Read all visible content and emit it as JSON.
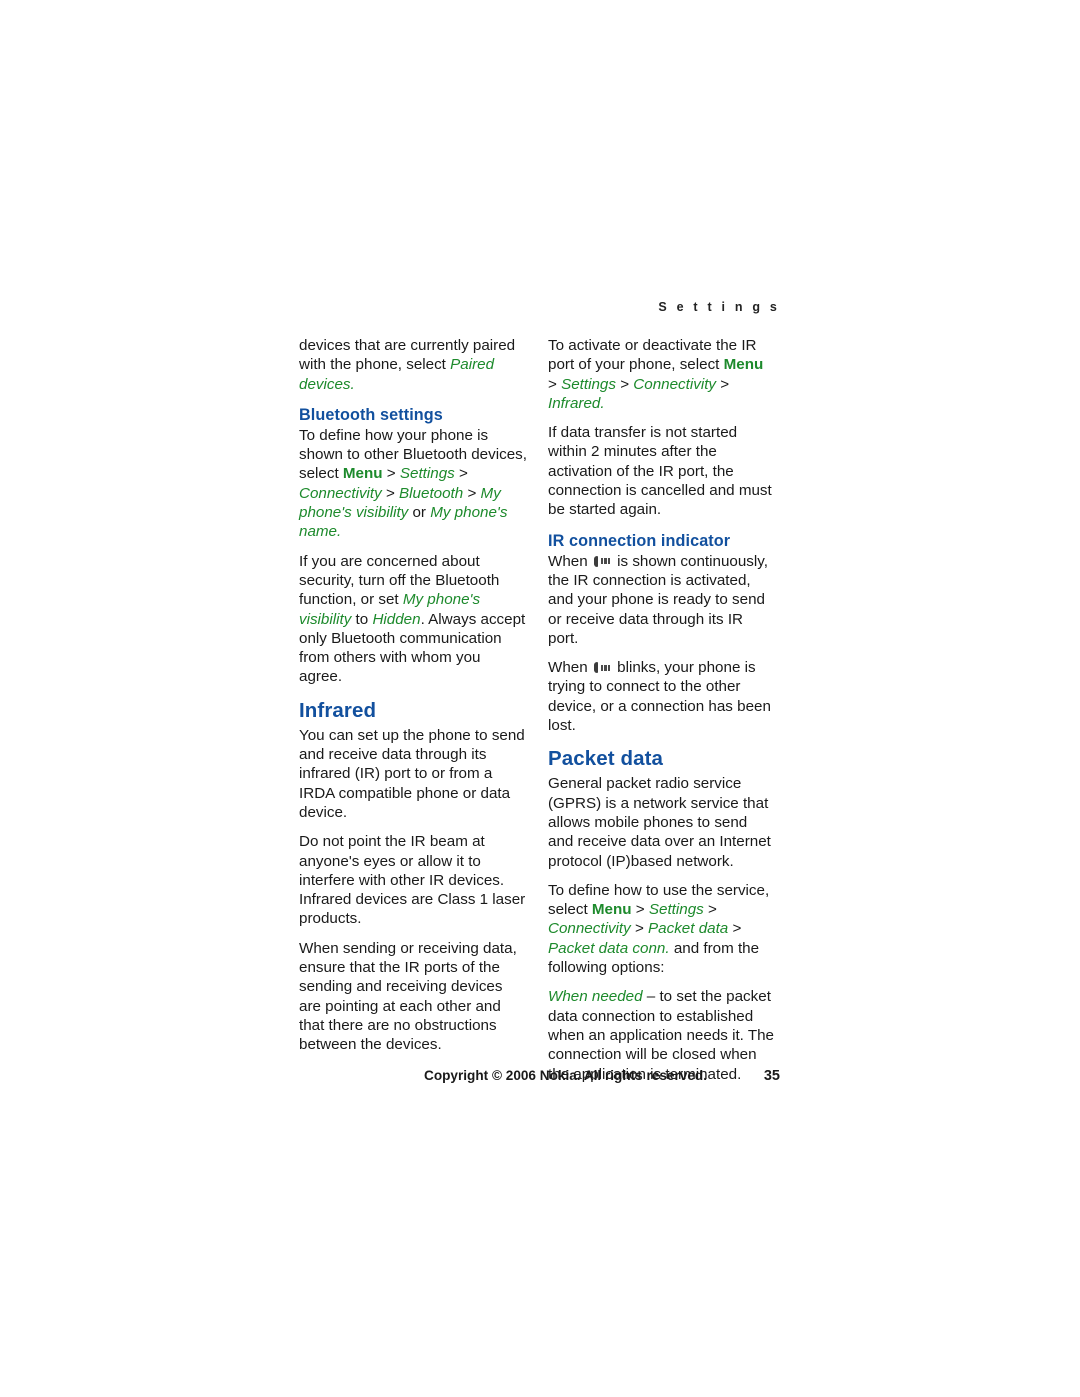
{
  "page": {
    "running_head": "S e t t i n g s",
    "page_number": "35",
    "copyright": "Copyright © 2006 Nokia. All rights reserved.",
    "heading_color": "#12509e",
    "path_color": "#1d8a2c",
    "body_color": "#1a1a1a"
  },
  "left_column": {
    "para_paired": {
      "lead": "devices that are currently paired with the phone, select ",
      "path": "Paired devices",
      "tail": "."
    },
    "bluetooth_settings": {
      "heading": "Bluetooth settings",
      "para1": {
        "lead": "To define how your phone is shown to other Bluetooth devices, select ",
        "menu": "Menu",
        "s1": " > ",
        "p1": "Settings",
        "s2": " > ",
        "p2": "Connectivity",
        "s3": " > ",
        "p3": "Bluetooth",
        "s4": " > ",
        "p4": "My phone's visibility",
        "mid": " or ",
        "p5": "My phone's name",
        "tail": "."
      },
      "para2": {
        "lead": "If you are concerned about security, turn off the Bluetooth function, or set ",
        "p1": "My phone's visibility",
        "mid": " to ",
        "p2": "Hidden",
        "tail": ". Always accept only Bluetooth communication from others with whom you agree."
      }
    },
    "infrared": {
      "heading": "Infrared",
      "para1": "You can set up the phone to send and receive data through its infrared (IR) port to or from a IRDA compatible phone or data device.",
      "para2": "Do not point the IR beam at anyone's eyes or allow it to interfere with other IR devices. Infrared devices are Class 1 laser products.",
      "para3": "When sending or receiving data, ensure that the IR ports of the sending and receiving devices are pointing at each other and that there are no obstructions between the devices."
    }
  },
  "right_column": {
    "para_activate": {
      "lead": "To activate or deactivate the IR port of your phone, select ",
      "menu": "Menu",
      "s1": " > ",
      "p1": "Settings",
      "s2": " > ",
      "p2": "Connectivity",
      "s3": " > ",
      "p3": "Infrared",
      "tail": "."
    },
    "para_timeout": "If data transfer is not started within 2 minutes after the activation of the IR port, the connection is cancelled and must be started again.",
    "ir_indicator": {
      "heading": "IR connection indicator",
      "icon_name": "ir-connection-icon",
      "para1_lead": "When ",
      "para1_tail": " is shown continuously, the IR connection is activated, and your phone is ready to send or receive data through its IR port.",
      "para2_lead": "When ",
      "para2_tail": " blinks, your phone is trying to connect to the other device, or a connection has been lost."
    },
    "packet_data": {
      "heading": "Packet data",
      "para1": "General packet radio service (GPRS) is a network service that allows mobile phones to send and receive data over an Internet protocol (IP)based network.",
      "para2": {
        "lead": "To define how to use the service, select ",
        "menu": "Menu",
        "s1": " > ",
        "p1": "Settings",
        "s2": " > ",
        "p2": "Connectivity",
        "s3": " > ",
        "p3": "Packet data",
        "s4": " > ",
        "p4": "Packet data conn.",
        "tail": " and from the following options:"
      },
      "para3": {
        "term": "When needed",
        "tail": " – to set the packet data connection to established when an application needs it. The connection will be closed when the application is terminated."
      }
    }
  }
}
